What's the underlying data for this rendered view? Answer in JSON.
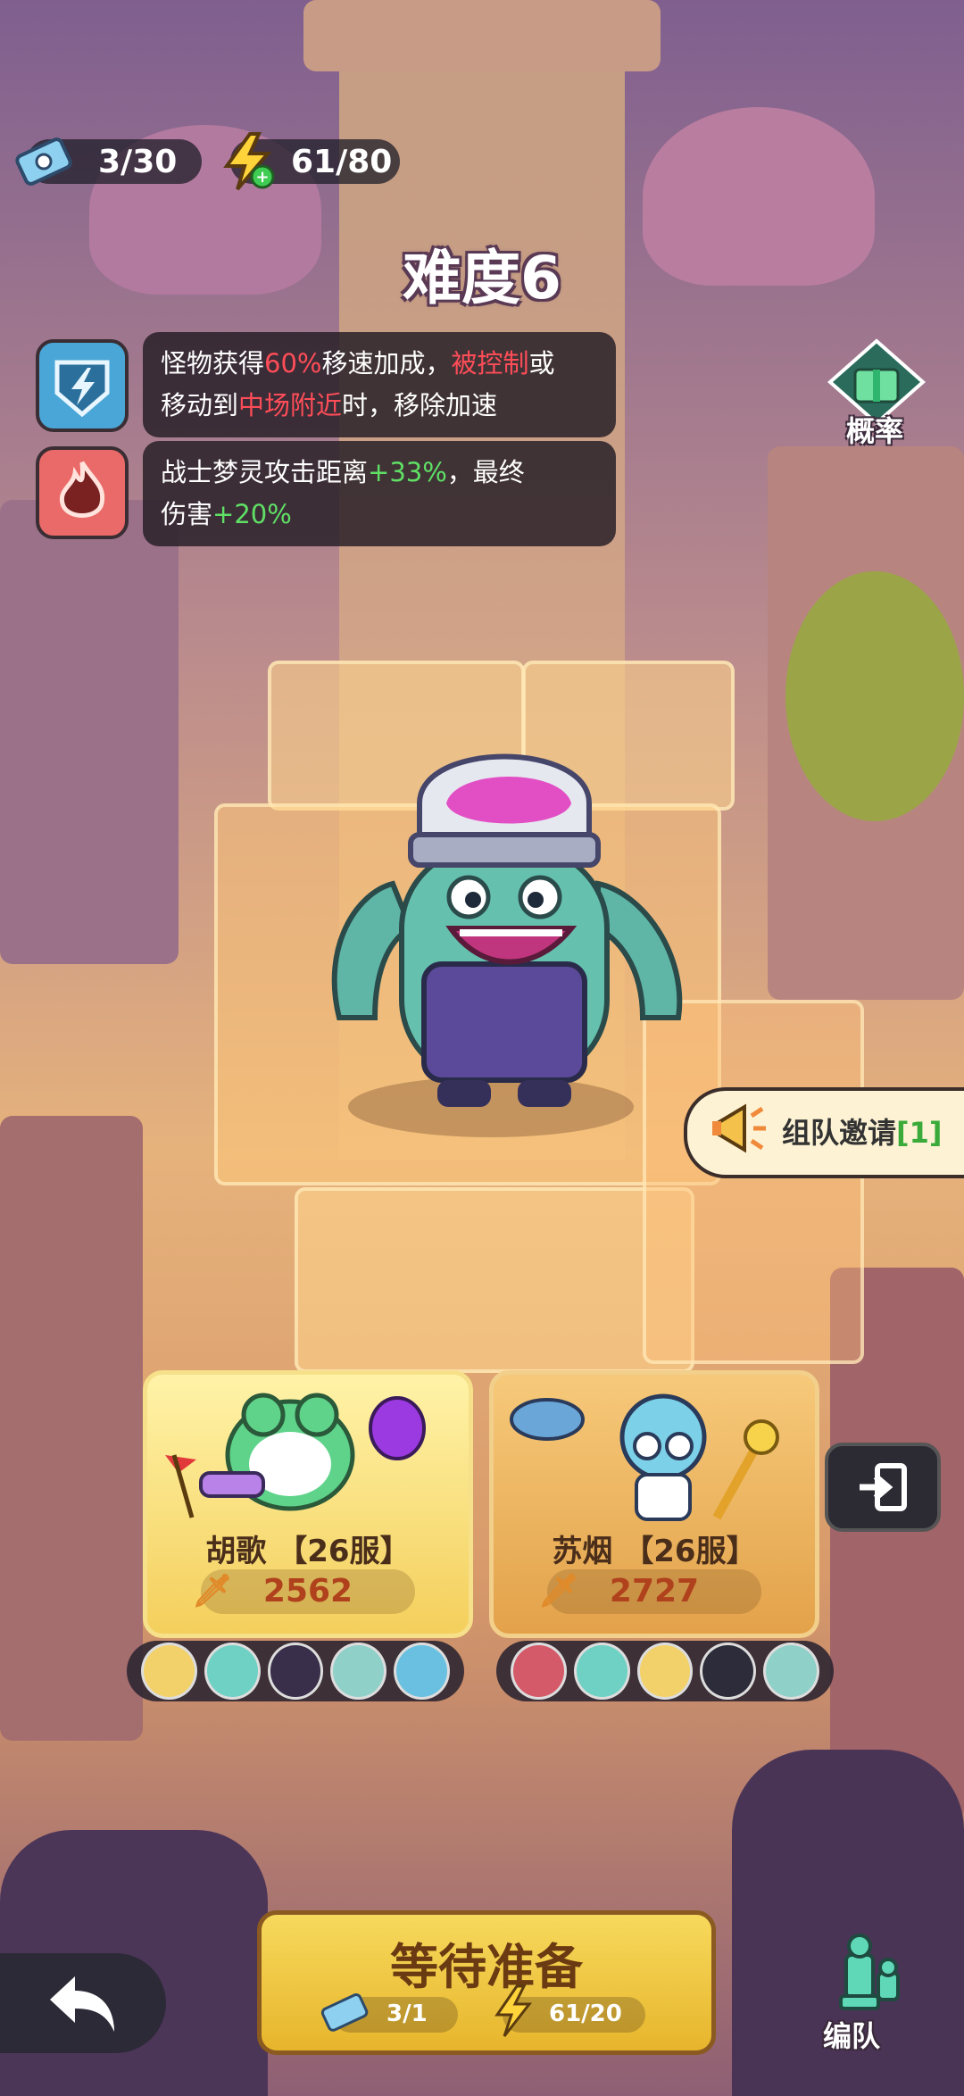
{
  "resources": {
    "tickets": "3/30",
    "energy": "61/80"
  },
  "stage": {
    "title": "难度6"
  },
  "buffs": [
    {
      "icon": "lightning-shield-icon",
      "parts": [
        "怪物获得",
        "60%",
        "移速加成，",
        "被控制",
        "或",
        "移动到",
        "中场附近",
        "时，移除加速"
      ]
    },
    {
      "icon": "flame-icon",
      "parts": [
        "战士梦灵攻击距离",
        "+33%",
        "，最终",
        "伤害",
        "+20%"
      ]
    }
  ],
  "side": {
    "probability_label": "概率",
    "team_invite_label": "组队邀请",
    "team_invite_count": "[1]"
  },
  "players": [
    {
      "name": "胡歌 【26服】",
      "power": "2562",
      "team": [
        "avatar-1",
        "avatar-2",
        "avatar-3",
        "avatar-4",
        "avatar-5"
      ]
    },
    {
      "name": "苏烟 【26服】",
      "power": "2727",
      "team": [
        "avatar-1",
        "avatar-2",
        "avatar-3",
        "avatar-4",
        "avatar-5"
      ]
    }
  ],
  "bottom": {
    "ready_label": "等待准备",
    "ticket_cost": "3/1",
    "energy_cost": "61/20",
    "formation_label": "编队"
  },
  "colors": {
    "highlight_red": "#ff4d58",
    "highlight_green": "#5fe065",
    "ready_button": "#f1c83d"
  }
}
